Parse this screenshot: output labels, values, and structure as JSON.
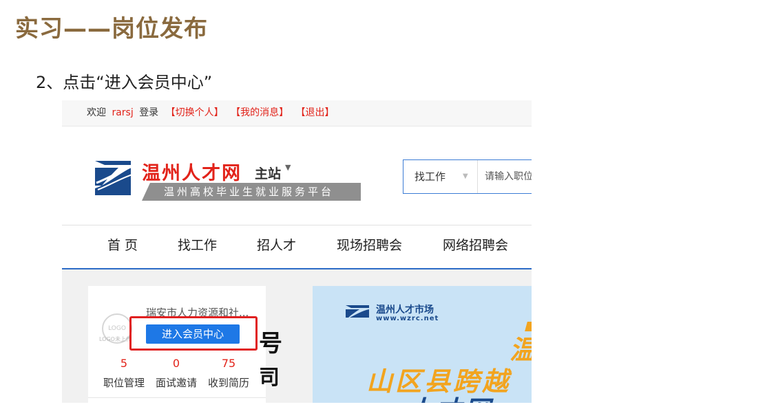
{
  "slide": {
    "title": "实习——岗位发布",
    "step": "2、点击“进入会员中心”"
  },
  "topbar": {
    "welcome": "欢迎",
    "username": "rarsj",
    "login_text": "登录",
    "links": [
      "【切换个人】",
      "【我的消息】",
      "【退出】"
    ]
  },
  "header": {
    "brand": "温州人才网",
    "site": "主站",
    "slogan": "温州高校毕业生就业服务平台",
    "search_type": "找工作",
    "search_placeholder": "请输入职位"
  },
  "nav": {
    "items": [
      "首 页",
      "找工作",
      "招人才",
      "现场招聘会",
      "网络招聘会"
    ]
  },
  "member": {
    "logo_placeholder": "LOGO",
    "logo_caption": "LOGO未上传",
    "company_name": "瑞安市人力资源和社...",
    "enter_button": "进入会员中心",
    "stats": [
      {
        "value": "5",
        "label": "职位管理"
      },
      {
        "value": "0",
        "label": "面试邀请"
      },
      {
        "value": "75",
        "label": "收到简历"
      }
    ]
  },
  "background_glyphs": [
    "号",
    "司"
  ],
  "banner": {
    "brand": "温州人才市场",
    "url": "www.wzrc.net",
    "line1": "温",
    "line2": "山区县跨越",
    "line3": "人才网"
  },
  "colors": {
    "title_brown": "#8a6a3e",
    "brand_red": "#e2231a",
    "button_blue": "#1e78e6",
    "highlight_red": "#e02020",
    "banner_blue": "#c9e3f6",
    "banner_orange": "#f2a41f"
  }
}
